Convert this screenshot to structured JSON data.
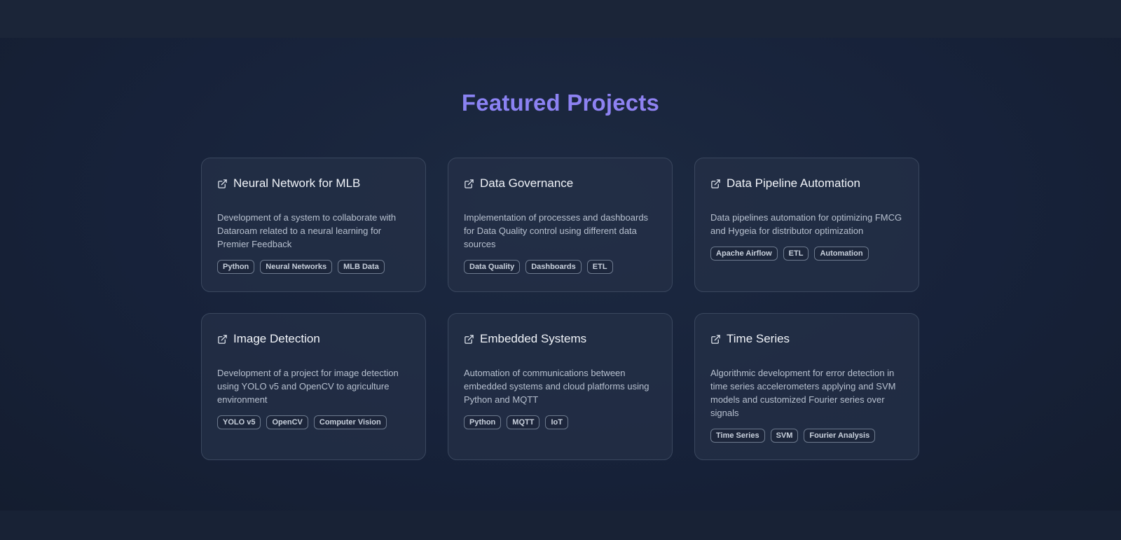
{
  "section": {
    "title": "Featured Projects"
  },
  "colors": {
    "title_gradient_start": "#7f86f5",
    "title_gradient_end": "#9a7ef0",
    "background": "#162032",
    "card_background": "#243046"
  },
  "projects": [
    {
      "title": "Neural Network for MLB",
      "icon": "external-link-icon",
      "description": "Development of a system to collaborate with Dataroam related to a neural learning for Premier Feedback",
      "tags": [
        "Python",
        "Neural Networks",
        "MLB Data"
      ]
    },
    {
      "title": "Data Governance",
      "icon": "external-link-icon",
      "description": "Implementation of processes and dashboards for Data Quality control using different data sources",
      "tags": [
        "Data Quality",
        "Dashboards",
        "ETL"
      ]
    },
    {
      "title": "Data Pipeline Automation",
      "icon": "external-link-icon",
      "description": "Data pipelines automation for optimizing FMCG and Hygeia for distributor optimization",
      "tags": [
        "Apache Airflow",
        "ETL",
        "Automation"
      ]
    },
    {
      "title": "Image Detection",
      "icon": "external-link-icon",
      "description": "Development of a project for image detection using YOLO v5 and OpenCV to agriculture environment",
      "tags": [
        "YOLO v5",
        "OpenCV",
        "Computer Vision"
      ]
    },
    {
      "title": "Embedded Systems",
      "icon": "external-link-icon",
      "description": "Automation of communications between embedded systems and cloud platforms using Python and MQTT",
      "tags": [
        "Python",
        "MQTT",
        "IoT"
      ]
    },
    {
      "title": "Time Series",
      "icon": "external-link-icon",
      "description": "Algorithmic development for error detection in time series accelerometers applying and SVM models and customized Fourier series over signals",
      "tags": [
        "Time Series",
        "SVM",
        "Fourier Analysis"
      ]
    }
  ]
}
